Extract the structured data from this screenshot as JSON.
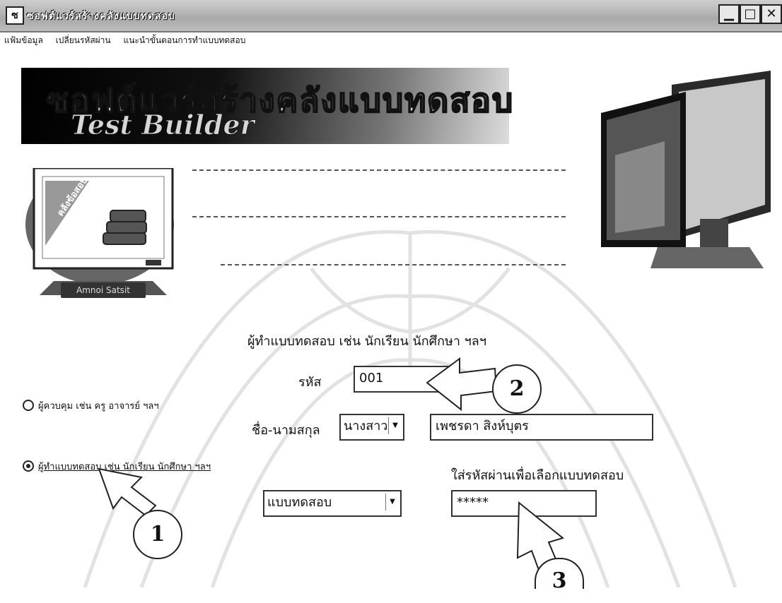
{
  "window": {
    "title": "ซอฟต์แวร์สร้างคลังแบบทดสอบ",
    "controls": {
      "minimize": "▁",
      "maximize": "□",
      "close": "✕"
    }
  },
  "menu": [
    {
      "label": "แฟ้มข้อมูล"
    },
    {
      "label": "เปลี่ยนรหัสผ่าน"
    },
    {
      "label": "แนะนำขั้นตอนการทำแบบทดสอบ"
    }
  ],
  "banner": {
    "thai_title": "ซอฟต์แวร์สร้างคลังแบบทดสอบ",
    "english_title": "Test Builder"
  },
  "monitor": {
    "screen_text": "คลังข้อสอบ",
    "label": "Amnoi Satsit"
  },
  "form": {
    "heading": "ผู้ทำแบบทดสอบ เช่น นักเรียน นักศึกษา ฯลฯ",
    "id_label": "รหัส",
    "id_value": "001",
    "name_label": "ชื่อ-นามสกุล",
    "prefix_value": "นางสาว",
    "fullname_value": "เพชรดา  สิงห์บุตร",
    "password_hint": "ใส่รหัสผ่านเพื่อเลือกแบบทดสอบ",
    "test_select_value": "แบบทดสอบ",
    "password_value": "*****"
  },
  "roles": [
    {
      "label": "ผู้ควบคุม เช่น ครู อาจารย์ ฯลฯ",
      "selected": false
    },
    {
      "label": "ผู้ทำแบบทดสอบ เช่น นักเรียน นักศึกษา ฯลฯ",
      "selected": true
    }
  ],
  "callouts": [
    "1",
    "2",
    "3"
  ]
}
